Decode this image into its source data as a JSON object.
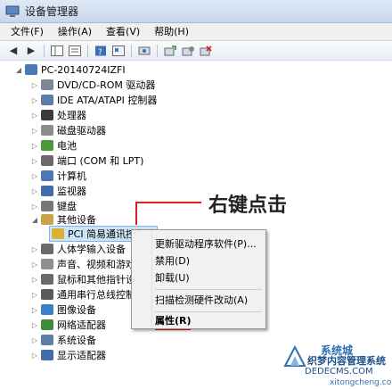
{
  "window": {
    "title": "设备管理器"
  },
  "menu": [
    "文件(F)",
    "操作(A)",
    "查看(V)",
    "帮助(H)"
  ],
  "tree": {
    "root": "PC-20140724IZFI",
    "items": [
      {
        "label": "DVD/CD-ROM 驱动器",
        "icon": "dvd-drive-icon",
        "color": "#7a8795"
      },
      {
        "label": "IDE ATA/ATAPI 控制器",
        "icon": "ide-controller-icon",
        "color": "#5b7fa8"
      },
      {
        "label": "处理器",
        "icon": "processor-icon",
        "color": "#3b3b3b"
      },
      {
        "label": "磁盘驱动器",
        "icon": "disk-drive-icon",
        "color": "#8d8d8d"
      },
      {
        "label": "电池",
        "icon": "battery-icon",
        "color": "#4a9a3a"
      },
      {
        "label": "端口 (COM 和 LPT)",
        "icon": "port-icon",
        "color": "#6a6a6a"
      },
      {
        "label": "计算机",
        "icon": "computer-icon",
        "color": "#4a78b5"
      },
      {
        "label": "监视器",
        "icon": "monitor-icon",
        "color": "#3f6fa6"
      },
      {
        "label": "键盘",
        "icon": "keyboard-icon",
        "color": "#777777"
      },
      {
        "label": "其他设备",
        "icon": "other-devices-icon",
        "color": "#c9a24a"
      },
      {
        "label": "PCI 简易通讯控制器",
        "icon": "unknown-device-warning-icon",
        "color": "#d9b23a"
      },
      {
        "label": "人体学输入设备",
        "icon": "hid-icon",
        "color": "#6a6a6a"
      },
      {
        "label": "声音、视频和游戏控制器",
        "icon": "sound-icon",
        "color": "#8f8f8f"
      },
      {
        "label": "鼠标和其他指针设备",
        "icon": "mouse-icon",
        "color": "#6a6a6a"
      },
      {
        "label": "通用串行总线控制器",
        "icon": "usb-icon",
        "color": "#5a5a5a"
      },
      {
        "label": "图像设备",
        "icon": "camera-icon",
        "color": "#3b7fc4"
      },
      {
        "label": "网络适配器",
        "icon": "network-adapter-icon",
        "color": "#3f8a3f"
      },
      {
        "label": "系统设备",
        "icon": "system-device-icon",
        "color": "#5b7fa8"
      },
      {
        "label": "显示适配器",
        "icon": "display-adapter-icon",
        "color": "#3f6fa6"
      }
    ]
  },
  "context_menu": {
    "items": [
      "更新驱动程序软件(P)...",
      "禁用(D)",
      "卸载(U)",
      "扫描检测硬件改动(A)",
      "属性(R)"
    ]
  },
  "annotation": {
    "text": "右键点击",
    "color": "#e21b1b"
  },
  "watermark": {
    "text": "系统城",
    "url": "xitongcheng.com",
    "site": "DEDECMS.COM",
    "caption": "织梦内容管理系统"
  }
}
